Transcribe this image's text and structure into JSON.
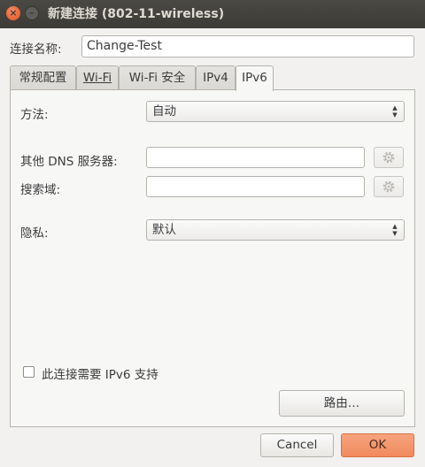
{
  "window": {
    "title": "新建连接 (802-11-wireless)",
    "close_icon": "close-icon",
    "minimize_icon": "minimize-icon"
  },
  "connection_name": {
    "label": "连接名称:",
    "value": "Change-Test"
  },
  "tabs": [
    {
      "label": "常规配置",
      "active": false
    },
    {
      "label": "Wi-Fi",
      "active": false
    },
    {
      "label": "Wi-Fi 安全",
      "active": false
    },
    {
      "label": "IPv4",
      "active": false
    },
    {
      "label": "IPv6",
      "active": true
    }
  ],
  "ipv6": {
    "method_label": "方法:",
    "method_value": "自动",
    "dns_label": "其他 DNS 服务器:",
    "dns_value": "",
    "search_label": "搜索域:",
    "search_value": "",
    "privacy_label": "隐私:",
    "privacy_value": "默认",
    "require_ipv6_label": "此连接需要 IPv6 支持",
    "require_ipv6_checked": false,
    "routes_button": "路由…"
  },
  "footer": {
    "cancel_label": "Cancel",
    "ok_label": "OK"
  },
  "colors": {
    "titlebar": "#3c3b37",
    "close_button": "#e95420",
    "ok_button": "#f18a5e",
    "background": "#f2f1f0"
  }
}
